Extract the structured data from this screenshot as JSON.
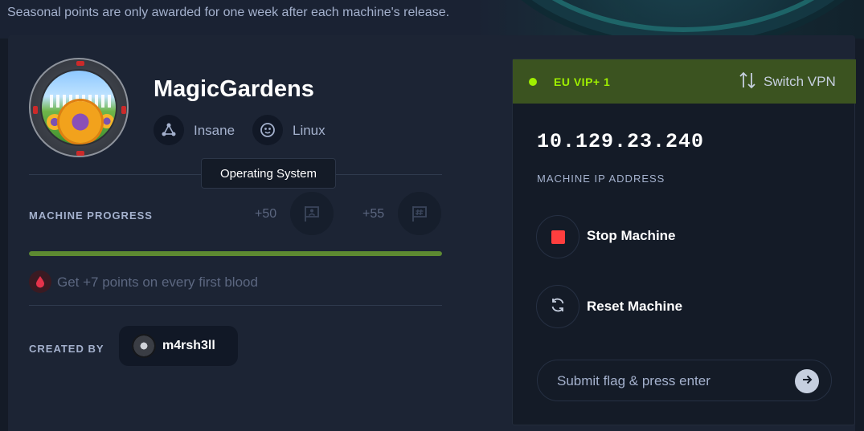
{
  "banner": {
    "text": "Seasonal points are only awarded for one week after each machine's release."
  },
  "machine": {
    "name": "MagicGardens",
    "difficulty": "Insane",
    "os": "Linux",
    "tooltip": "Operating System"
  },
  "progress": {
    "label": "MACHINE PROGRESS",
    "user_points": "+50",
    "root_points": "+55",
    "fraction": 1.0,
    "color": "#5d8a31"
  },
  "first_blood": {
    "text": "Get +7 points on every first blood"
  },
  "creator": {
    "label": "CREATED BY",
    "name": "m4rsh3ll"
  },
  "vpn": {
    "server": "EU VIP+ 1",
    "switch_label": "Switch VPN",
    "status_color": "#9fef00"
  },
  "target": {
    "ip": "10.129.23.240",
    "ip_label": "MACHINE IP ADDRESS"
  },
  "actions": {
    "stop_label": "Stop Machine",
    "reset_label": "Reset Machine"
  },
  "flag_submit": {
    "placeholder": "Submit flag & press enter"
  },
  "icons": {
    "difficulty": "difficulty-nodes-icon",
    "os": "linux-penguin-icon",
    "user_flag": "user-flag-icon",
    "root_flag": "root-flag-icon",
    "blood": "blood-drop-icon",
    "switch": "switch-arrows-icon",
    "stop": "stop-icon",
    "reset": "reset-icon",
    "submit": "arrow-right-icon"
  }
}
